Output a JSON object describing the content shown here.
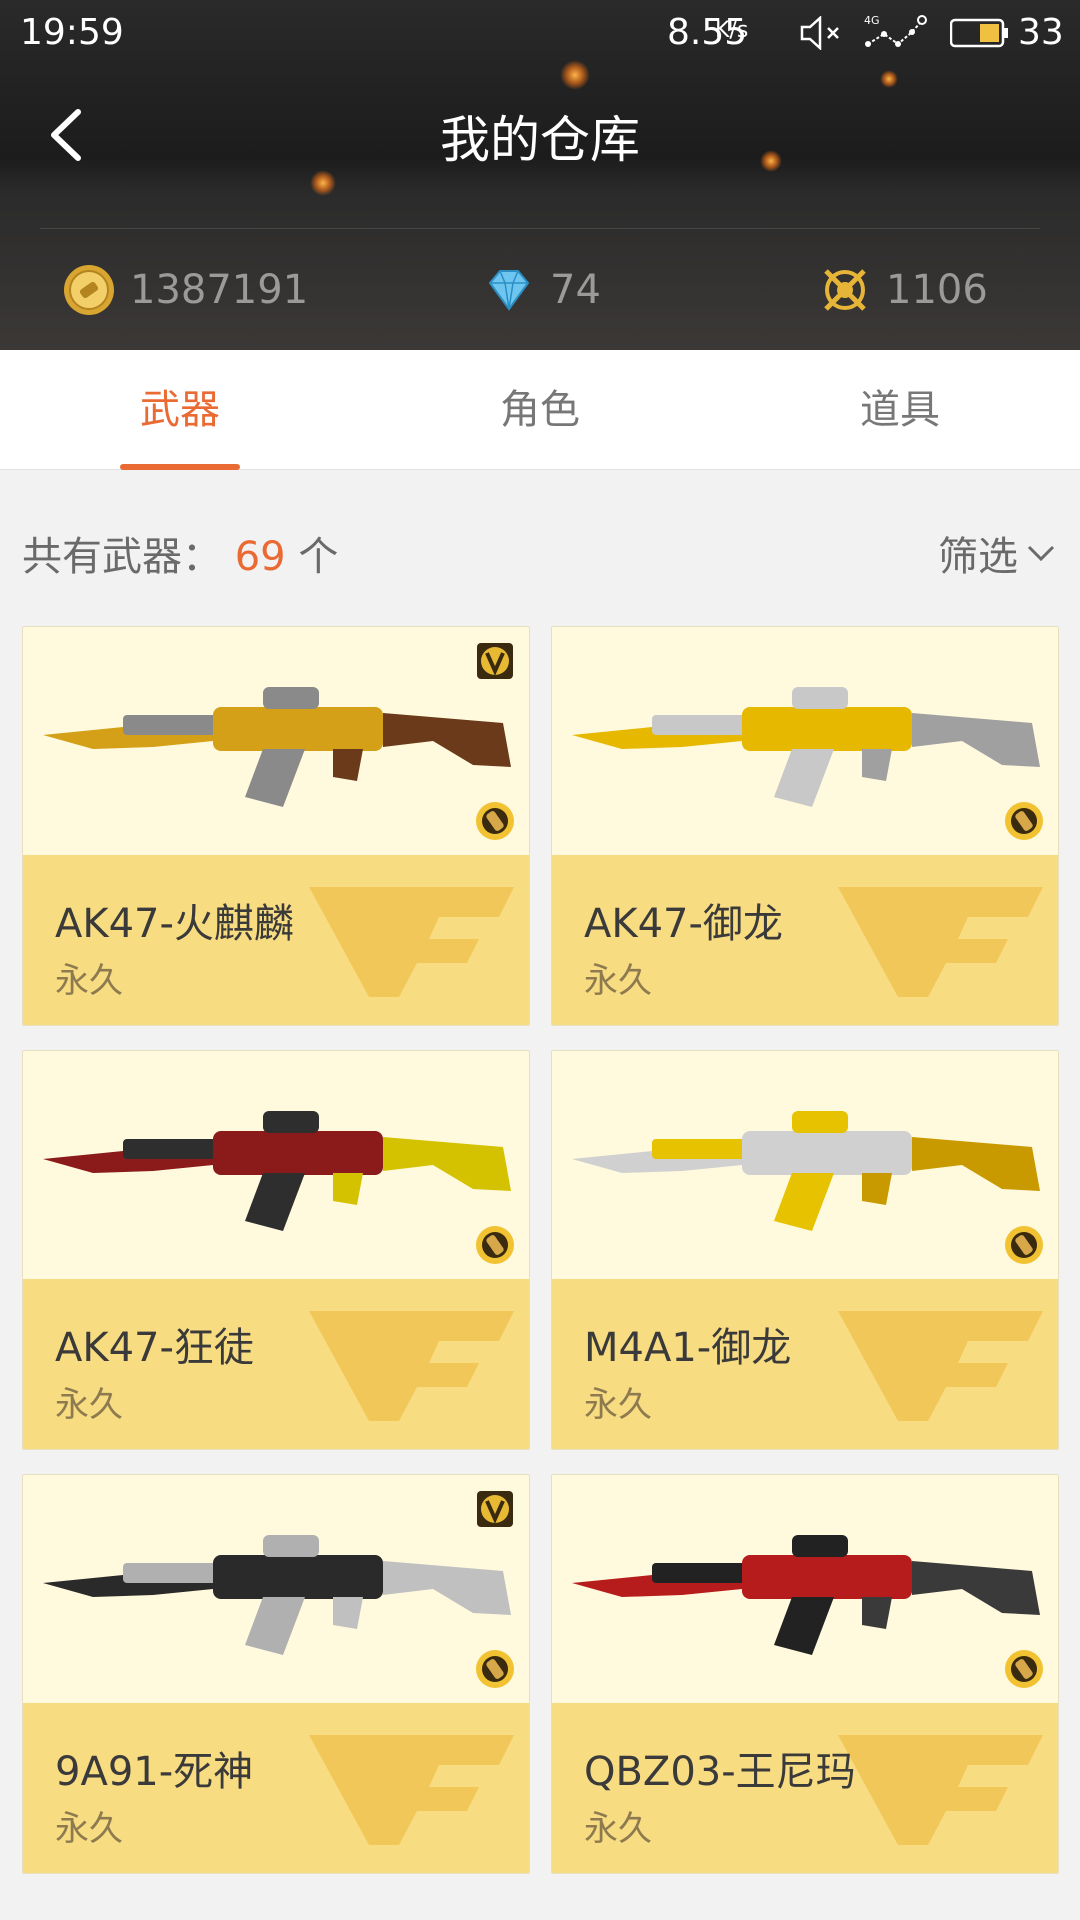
{
  "status_bar": {
    "time": "19:59",
    "net_speed": "8.55",
    "net_speed_unit": "K/s",
    "battery": "33"
  },
  "header": {
    "title": "我的仓库",
    "back_icon": "chevron-left-icon"
  },
  "currencies": [
    {
      "icon": "gold-coin-icon",
      "value": "1387191"
    },
    {
      "icon": "diamond-icon",
      "value": "74"
    },
    {
      "icon": "crossed-rifles-icon",
      "value": "1106"
    }
  ],
  "tabs": [
    {
      "label": "武器",
      "active": true
    },
    {
      "label": "角色",
      "active": false
    },
    {
      "label": "道具",
      "active": false
    }
  ],
  "summary": {
    "prefix": "共有武器：",
    "count": "69",
    "suffix": "个",
    "filter_label": "筛选"
  },
  "weapons": [
    {
      "name": "AK47-火麒麟",
      "duration": "永久",
      "vip": true,
      "gun_colors": [
        "#8a8a8a",
        "#d4a017",
        "#6b3a1a"
      ]
    },
    {
      "name": "AK47-御龙",
      "duration": "永久",
      "vip": false,
      "gun_colors": [
        "#c8c8c8",
        "#e6b800",
        "#a0a0a0"
      ]
    },
    {
      "name": "AK47-狂徒",
      "duration": "永久",
      "vip": false,
      "gun_colors": [
        "#2e2e2e",
        "#8b1a1a",
        "#d4c200"
      ]
    },
    {
      "name": "M4A1-御龙",
      "duration": "永久",
      "vip": false,
      "gun_colors": [
        "#e6c200",
        "#d0d0d0",
        "#c89a00"
      ]
    },
    {
      "name": "9A91-死神",
      "duration": "永久",
      "vip": true,
      "gun_colors": [
        "#b0b0b0",
        "#2a2a2a",
        "#c0c0c0"
      ]
    },
    {
      "name": "QBZ03-王尼玛",
      "duration": "永久",
      "vip": false,
      "gun_colors": [
        "#222222",
        "#b71c1c",
        "#3a3a3a"
      ]
    }
  ],
  "colors": {
    "accent": "#e96b33",
    "card_info_bg": "#f8dc82",
    "card_image_bg": "#fff9dd"
  }
}
